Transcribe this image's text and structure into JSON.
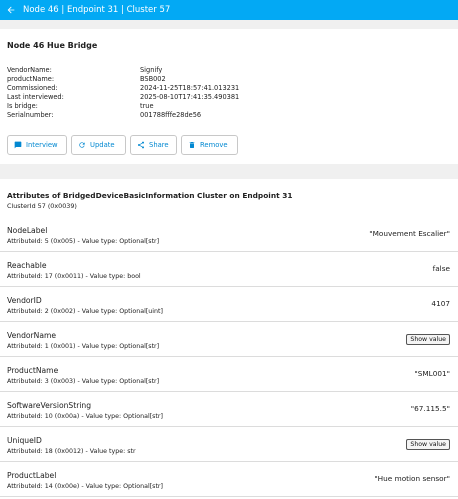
{
  "header": {
    "title": "Node 46 | Endpoint 31 | Cluster 57",
    "back_icon": "arrow-left-icon",
    "bar_color": "#03a9f4"
  },
  "node": {
    "title": "Node 46 Hue Bridge",
    "info": [
      {
        "key": "VendorName:",
        "value": "Signify"
      },
      {
        "key": "productName:",
        "value": "BSB002"
      },
      {
        "key": "Commissioned:",
        "value": "2024-11-25T18:57:41.013231"
      },
      {
        "key": "Last interviewed:",
        "value": "2025-08-10T17:41:35.490381"
      },
      {
        "key": "Is bridge:",
        "value": "true"
      },
      {
        "key": "Serialnumber:",
        "value": "001788fffe28de56"
      }
    ],
    "actions": [
      {
        "label": "Interview",
        "icon": "chat-icon"
      },
      {
        "label": "Update",
        "icon": "update-icon"
      },
      {
        "label": "Share",
        "icon": "share-icon"
      },
      {
        "label": "Remove",
        "icon": "trash-icon"
      }
    ],
    "accent_color": "#0288d1"
  },
  "attributes": {
    "title": "Attributes of BridgedDeviceBasicInformation Cluster on Endpoint 31",
    "subtitle": "ClusterId 57 (0x0039)",
    "show_value_label": "Show value",
    "items": [
      {
        "name": "NodeLabel",
        "meta": "AttributeId: 5 (0x005) - Value type: Optional[str]",
        "value": "\"Mouvement Escalier\""
      },
      {
        "name": "Reachable",
        "meta": "AttributeId: 17 (0x0011) - Value type: bool",
        "value": "false"
      },
      {
        "name": "VendorID",
        "meta": "AttributeId: 2 (0x002) - Value type: Optional[uint]",
        "value": "4107"
      },
      {
        "name": "VendorName",
        "meta": "AttributeId: 1 (0x001) - Value type: Optional[str]",
        "value": null
      },
      {
        "name": "ProductName",
        "meta": "AttributeId: 3 (0x003) - Value type: Optional[str]",
        "value": "\"SML001\""
      },
      {
        "name": "SoftwareVersionString",
        "meta": "AttributeId: 10 (0x00a) - Value type: Optional[str]",
        "value": "\"67.115.5\""
      },
      {
        "name": "UniqueID",
        "meta": "AttributeId: 18 (0x0012) - Value type: str",
        "value": null
      },
      {
        "name": "ProductLabel",
        "meta": "AttributeId: 14 (0x00e) - Value type: Optional[str]",
        "value": "\"Hue motion sensor\""
      }
    ]
  }
}
